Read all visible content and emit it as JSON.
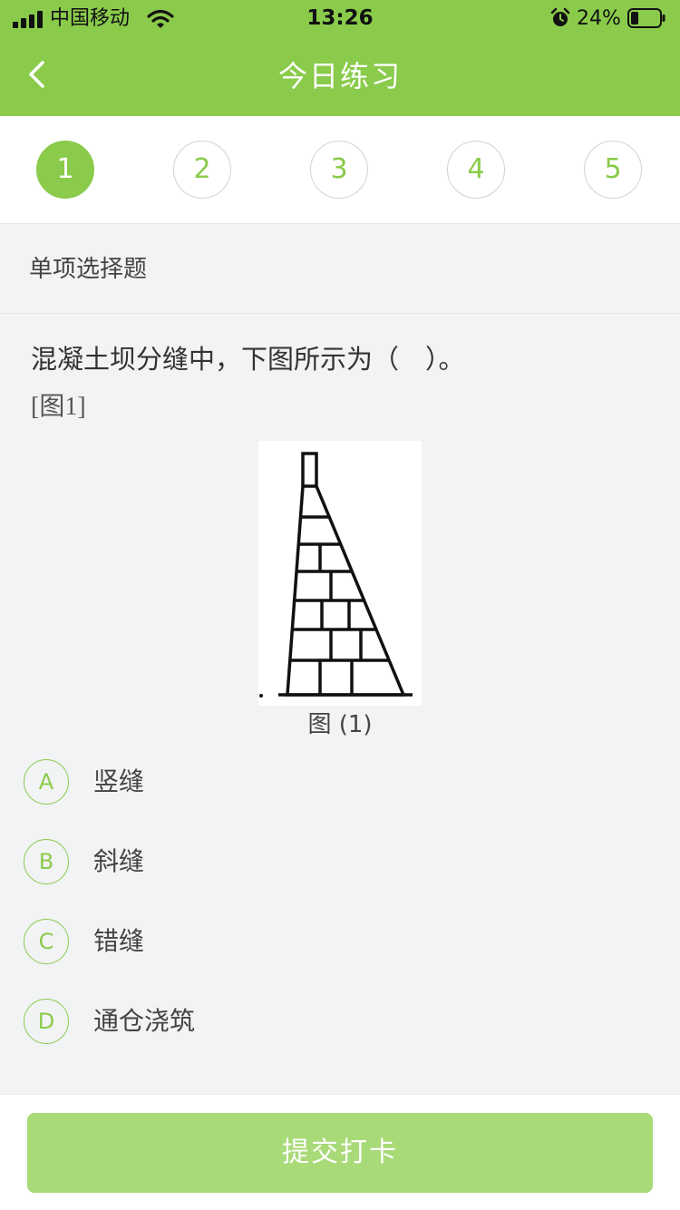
{
  "status_bar": {
    "carrier": "中国移动",
    "time": "13:26",
    "battery": "24%",
    "icons": [
      "signal-icon",
      "wifi-icon",
      "alarm-icon",
      "battery-icon"
    ]
  },
  "nav": {
    "title": "今日练习",
    "back_icon": "chevron-left-icon"
  },
  "steps": {
    "items": [
      "1",
      "2",
      "3",
      "4",
      "5"
    ],
    "active": "1"
  },
  "question": {
    "type": "单项选择题",
    "text": "混凝土坝分缝中，下图所示为（　）。",
    "figure_ref": "[图1]",
    "figure_caption": "图 (1)",
    "options": [
      {
        "letter": "A",
        "text": "竖缝"
      },
      {
        "letter": "B",
        "text": "斜缝"
      },
      {
        "letter": "C",
        "text": "错缝"
      },
      {
        "letter": "D",
        "text": "通仓浇筑"
      }
    ]
  },
  "submit_label": "提交打卡",
  "colors": {
    "brand_green": "#8acb4b",
    "submit_disabled": "#a9da78",
    "background": "#f2f3f5"
  }
}
